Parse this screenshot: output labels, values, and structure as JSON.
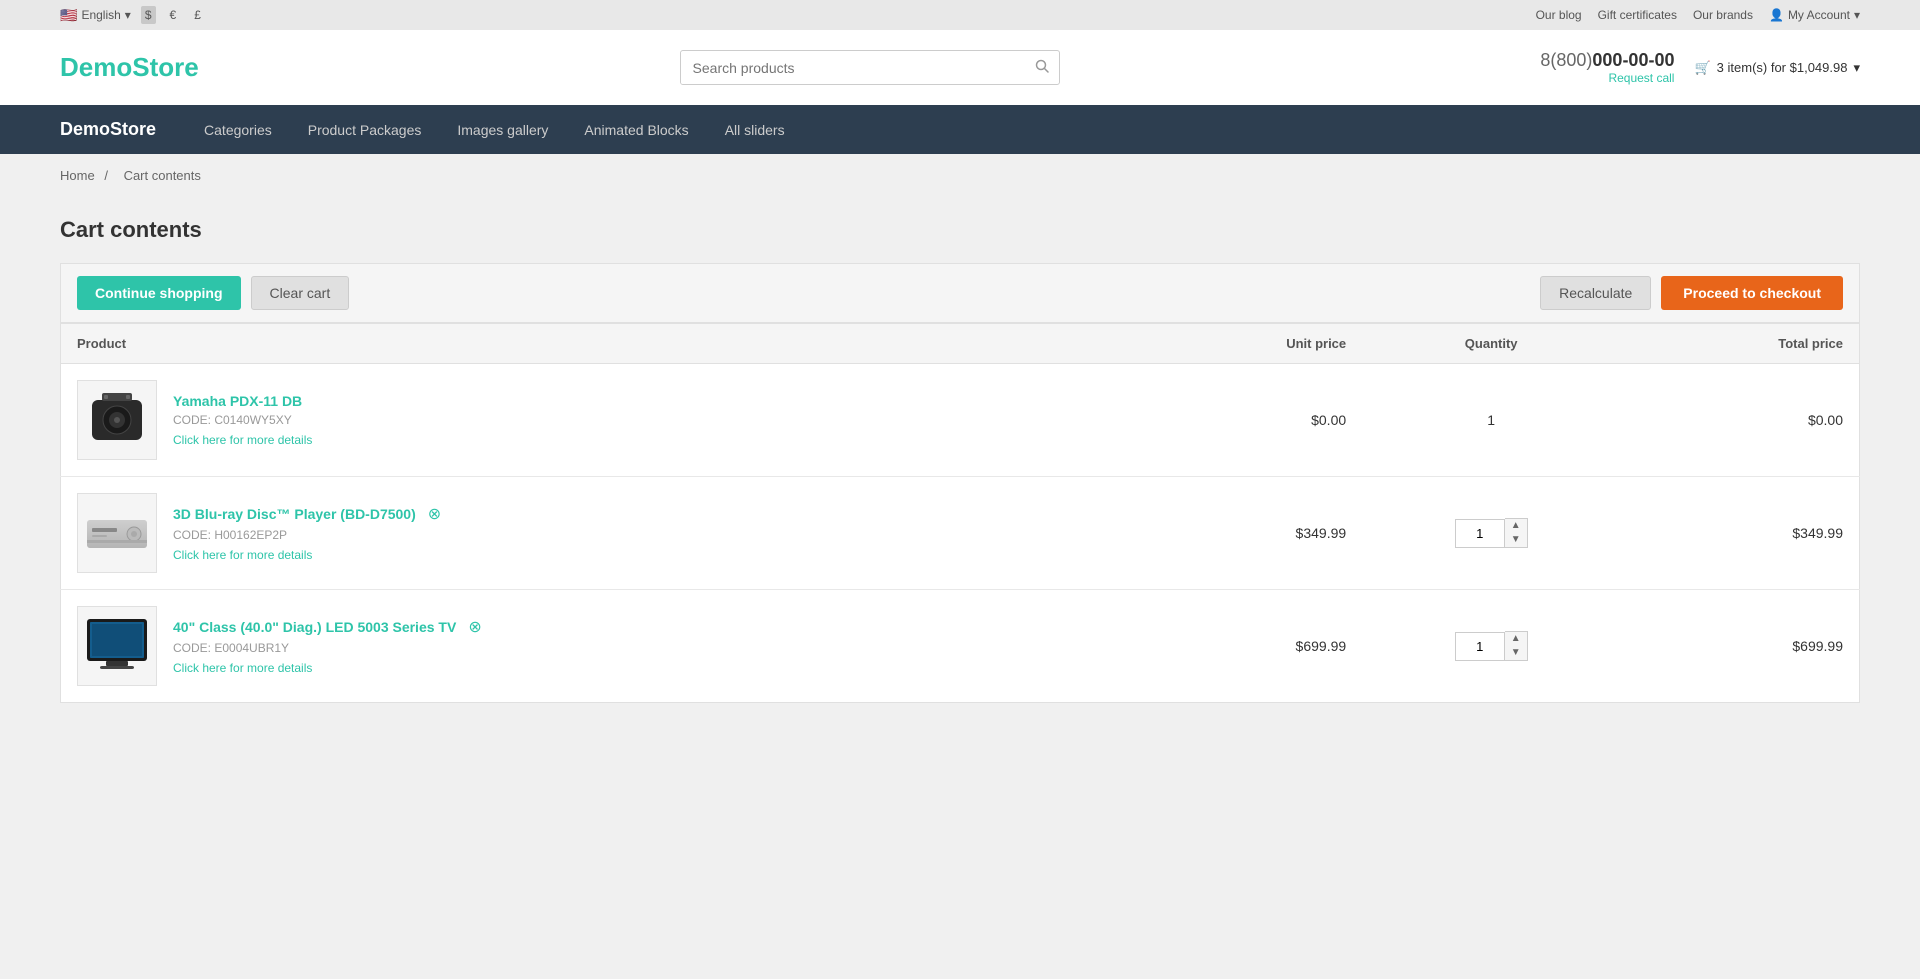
{
  "topbar": {
    "language": "English",
    "currencies": [
      "$",
      "€",
      "£"
    ],
    "active_currency": "$",
    "links": [
      {
        "label": "Our blog",
        "id": "our-blog"
      },
      {
        "label": "Gift certificates",
        "id": "gift-certificates"
      },
      {
        "label": "Our brands",
        "id": "our-brands"
      }
    ],
    "account": "My Account"
  },
  "header": {
    "logo_demo": "Demo",
    "logo_store": "Store",
    "search_placeholder": "Search products",
    "phone_prefix": "8(800)",
    "phone_main": "000-00-00",
    "request_call": "Request call",
    "cart_label": "3 item(s) for $1,049.98"
  },
  "nav": {
    "logo_demo": "Demo",
    "logo_store": "Store",
    "items": [
      {
        "label": "Categories"
      },
      {
        "label": "Product Packages"
      },
      {
        "label": "Images gallery"
      },
      {
        "label": "Animated Blocks"
      },
      {
        "label": "All sliders"
      }
    ]
  },
  "breadcrumb": {
    "home": "Home",
    "separator": "/",
    "current": "Cart contents"
  },
  "page": {
    "title": "Cart contents"
  },
  "cart_actions": {
    "continue_shopping": "Continue shopping",
    "clear_cart": "Clear cart",
    "recalculate": "Recalculate",
    "proceed_to_checkout": "Proceed to checkout"
  },
  "table_headers": {
    "product": "Product",
    "unit_price": "Unit price",
    "quantity": "Quantity",
    "total_price": "Total price"
  },
  "products": [
    {
      "id": 1,
      "name": "Yamaha PDX-11 DB",
      "code": "CODE: C0140WY5XY",
      "details_link": "Click here for more details",
      "unit_price": "$0.00",
      "quantity": "1",
      "total_price": "$0.00",
      "has_remove": false
    },
    {
      "id": 2,
      "name": "3D Blu-ray Disc™ Player (BD-D7500)",
      "code": "CODE: H00162EP2P",
      "details_link": "Click here for more details",
      "unit_price": "$349.99",
      "quantity": "1",
      "total_price": "$349.99",
      "has_remove": true
    },
    {
      "id": 3,
      "name": "40\" Class (40.0\" Diag.) LED 5003 Series TV",
      "code": "CODE: E0004UBR1Y",
      "details_link": "Click here for more details",
      "unit_price": "$699.99",
      "quantity": "1",
      "total_price": "$699.99",
      "has_remove": true
    }
  ]
}
